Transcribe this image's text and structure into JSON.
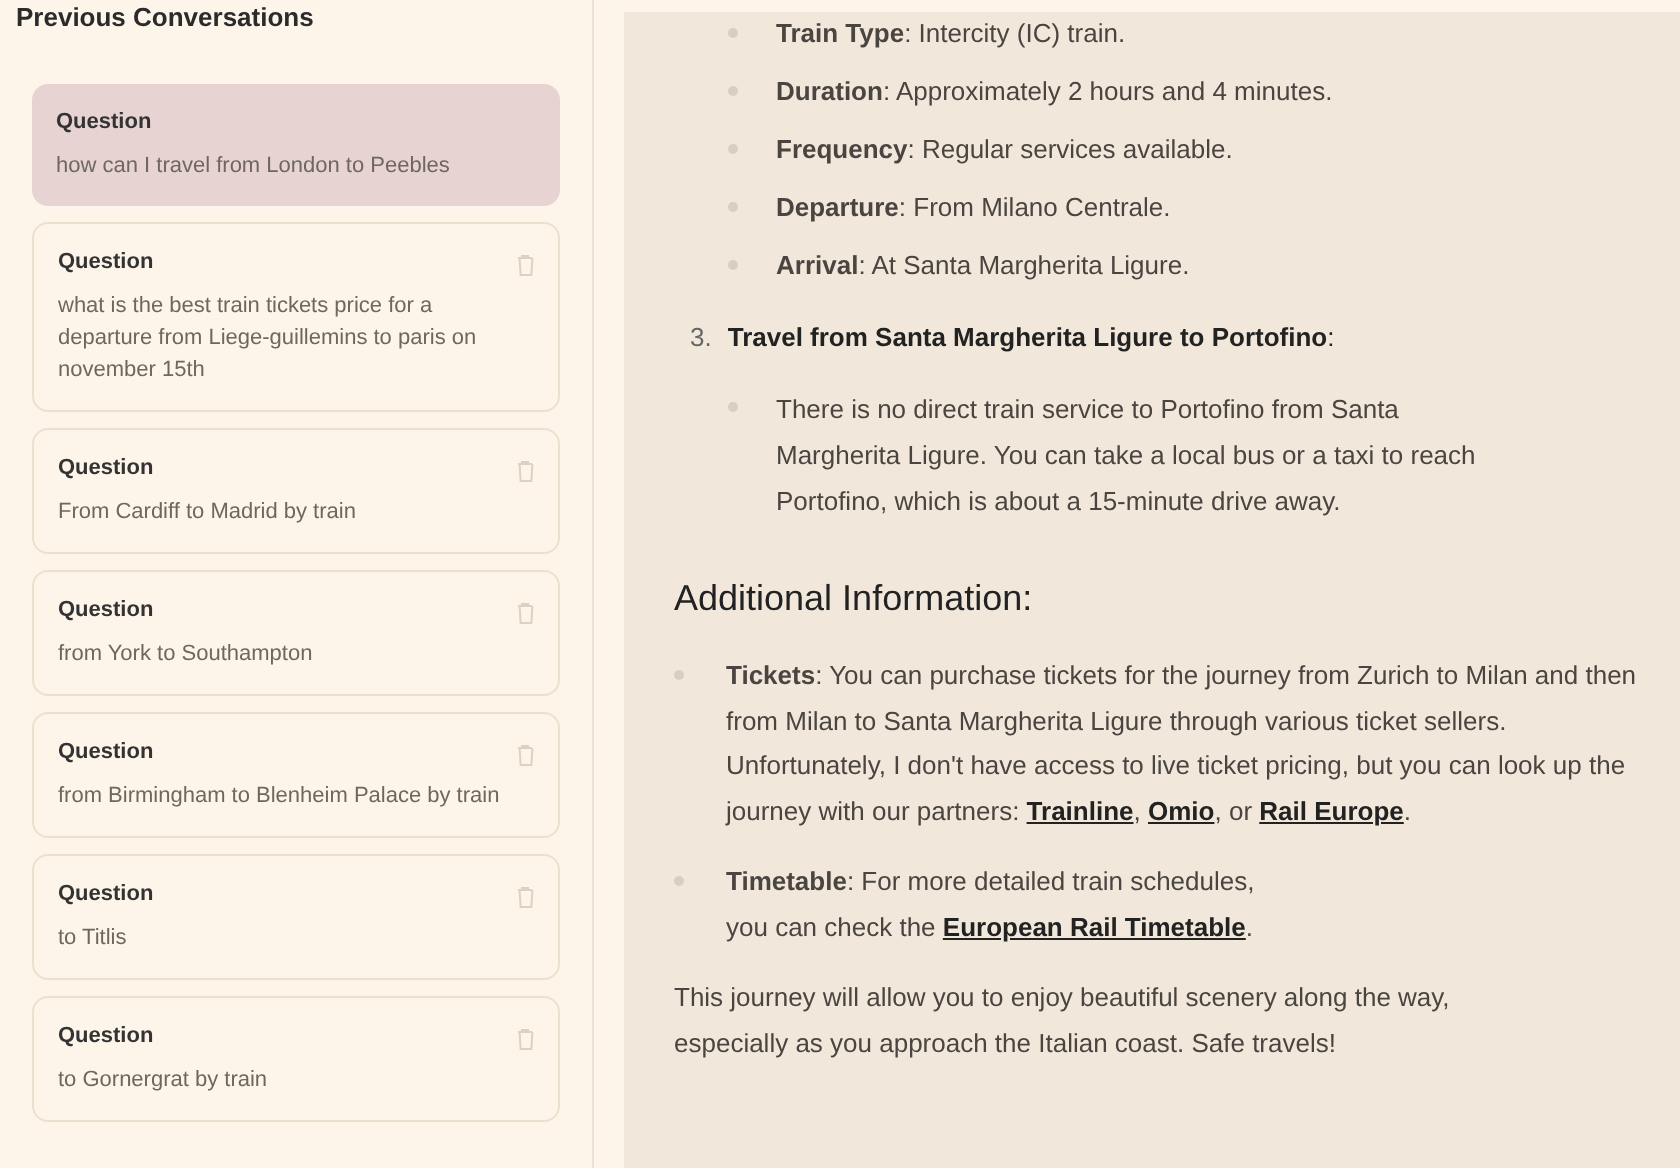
{
  "sidebar": {
    "title": "Previous Conversations",
    "conversations": [
      {
        "label": "Question",
        "text": "how can I travel from London to Peebles",
        "selected": true
      },
      {
        "label": "Question",
        "text": "what is the best train tickets price for a departure from Liege-guillemins to paris on november 15th",
        "selected": false
      },
      {
        "label": "Question",
        "text": "From Cardiff to Madrid by train",
        "selected": false
      },
      {
        "label": "Question",
        "text": "from York to Southampton",
        "selected": false
      },
      {
        "label": "Question",
        "text": "from Birmingham to Blenheim Palace by train",
        "selected": false
      },
      {
        "label": "Question",
        "text": "to Titlis",
        "selected": false
      },
      {
        "label": "Question",
        "text": "to Gornergrat by train",
        "selected": false
      }
    ]
  },
  "content": {
    "details": [
      "**Train Type**: Intercity (IC) train.",
      "**Duration**: Approximately 2 hours and 4 minutes.",
      "**Frequency**: Regular services available.",
      "**Departure**: From Milano Centrale.",
      "**Arrival**: At Santa Margherita Ligure."
    ],
    "step": {
      "number": "3.",
      "title": "**Travel from Santa Margherita Ligure to Portofino**:",
      "bullets": [
        "There is no direct train service to Portofino from Santa Margherita Ligure. You can take a local bus or a taxi to reach Portofino, which is about a 15-minute drive away."
      ]
    },
    "heading": "Additional Information:",
    "info": [
      {
        "parts": [
          {
            "kind": "text",
            "text": "**Tickets**: You can purchase tickets for the journey from Zurich to Milan and then from Milan to Santa Margherita Ligure through various ticket sellers. Unfortunately, I don't have access to live ticket pricing, but you can look up the journey with our partners: "
          },
          {
            "kind": "link",
            "text": "Trainline"
          },
          {
            "kind": "text",
            "text": ", "
          },
          {
            "kind": "link",
            "text": "Omio"
          },
          {
            "kind": "text",
            "text": ", or "
          },
          {
            "kind": "link",
            "text": "Rail Europe"
          },
          {
            "kind": "text",
            "text": "."
          }
        ]
      },
      {
        "parts": [
          {
            "kind": "text",
            "text": "**Timetable**: For more detailed train schedules,"
          },
          {
            "kind": "break"
          },
          {
            "kind": "text",
            "text": "you can check the "
          },
          {
            "kind": "link",
            "text": "European Rail Timetable"
          },
          {
            "kind": "text",
            "text": "."
          }
        ]
      }
    ],
    "closing": "This journey will allow you to enjoy beautiful scenery along the way, especially as you approach the Italian coast. Safe travels!"
  }
}
